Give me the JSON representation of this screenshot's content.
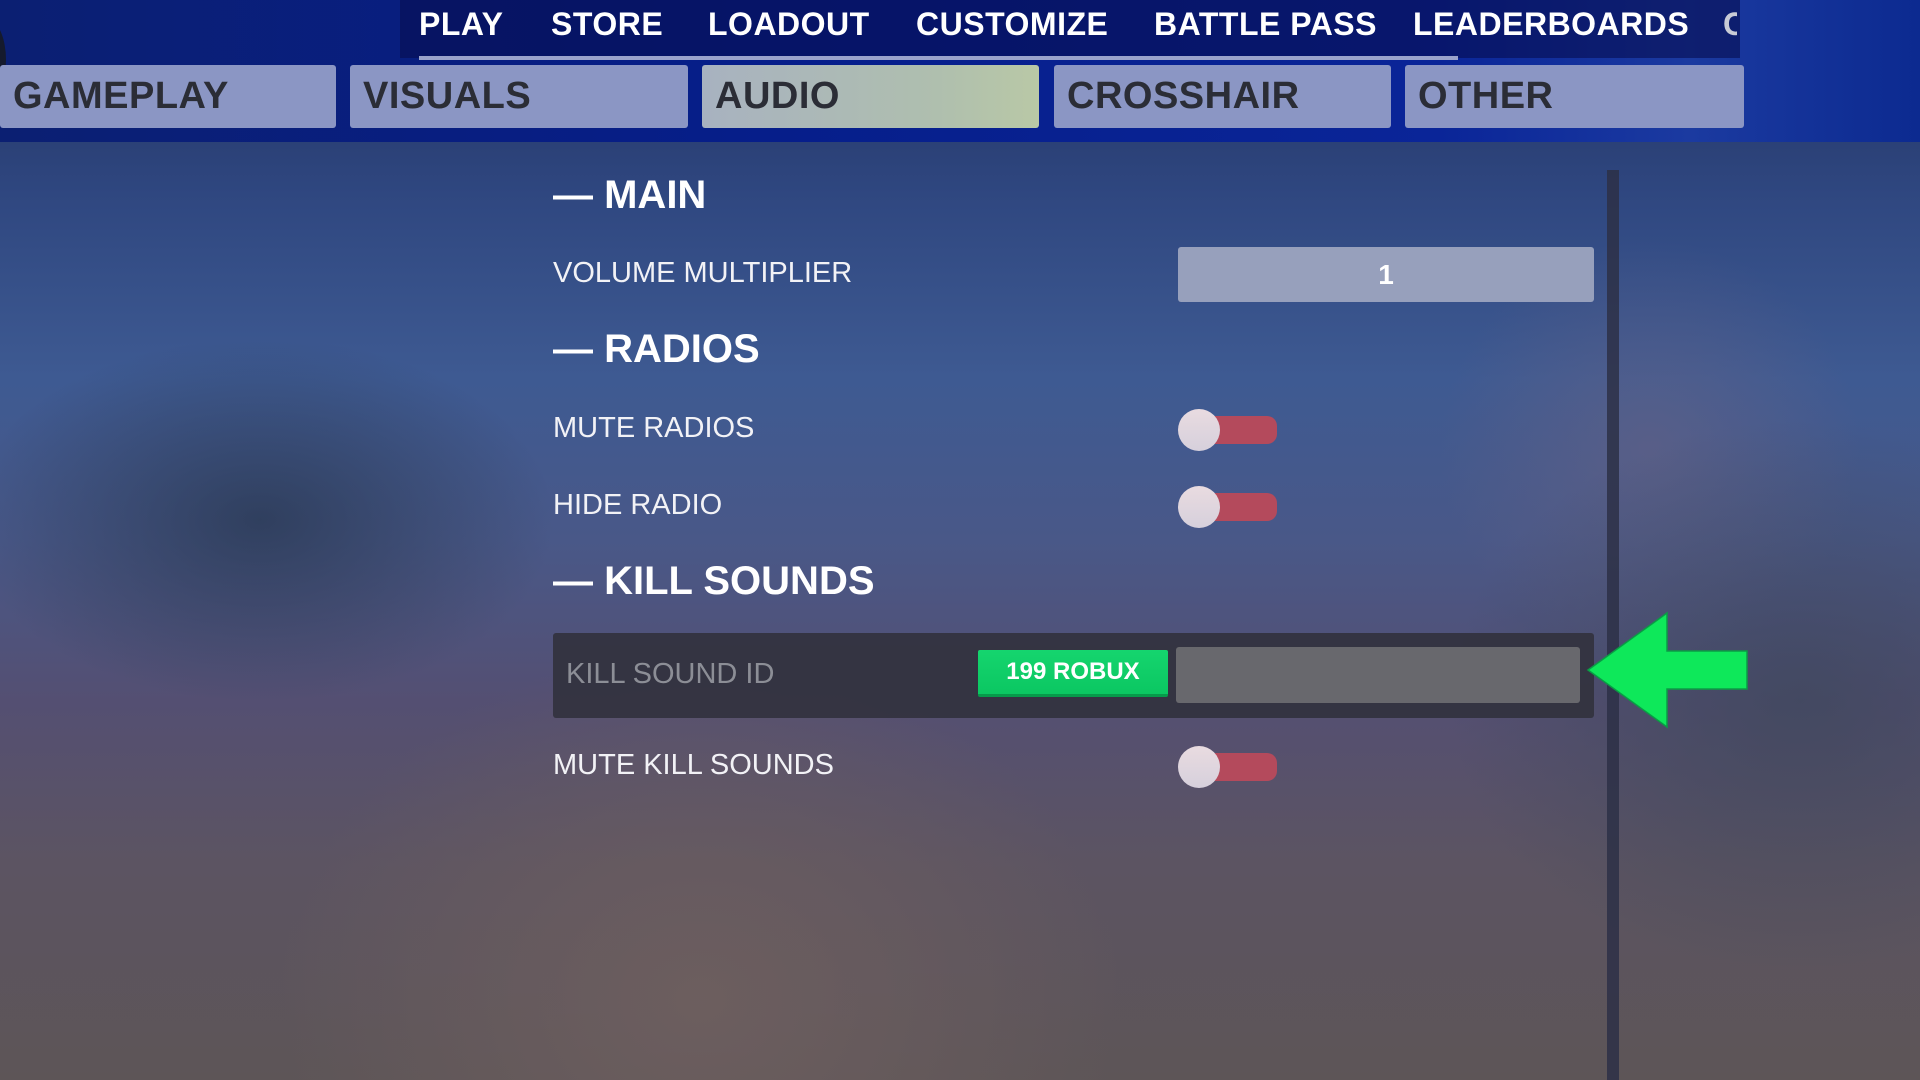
{
  "top_nav": {
    "items": [
      {
        "label": "PLAY"
      },
      {
        "label": "STORE"
      },
      {
        "label": "LOADOUT"
      },
      {
        "label": "CUSTOMIZE"
      },
      {
        "label": "BATTLE PASS"
      },
      {
        "label": "LEADERBOARDS"
      },
      {
        "label": "C"
      }
    ]
  },
  "settings_tabs": {
    "items": [
      {
        "label": "GAMEPLAY"
      },
      {
        "label": "VISUALS"
      },
      {
        "label": "AUDIO",
        "active": true
      },
      {
        "label": "CROSSHAIR"
      },
      {
        "label": "OTHER"
      }
    ]
  },
  "sections": {
    "main": {
      "title": "— MAIN",
      "volume_multiplier": {
        "label": "VOLUME MULTIPLIER",
        "value": "1"
      }
    },
    "radios": {
      "title": "— RADIOS",
      "mute_radios": {
        "label": "MUTE RADIOS",
        "enabled": false
      },
      "hide_radio": {
        "label": "HIDE RADIO",
        "enabled": false
      }
    },
    "kill_sounds": {
      "title": "— KILL SOUNDS",
      "kill_sound_id": {
        "label": "KILL SOUND ID",
        "purchase_label": "199 ROBUX",
        "value": "",
        "placeholder": ""
      },
      "mute_kill_sounds": {
        "label": "MUTE KILL SOUNDS",
        "enabled": false
      }
    }
  },
  "colors": {
    "toggle_off": "#b44a5c",
    "robux_button": "#12d068",
    "annotation_arrow": "#0ee85a",
    "active_tab": "#afbfae",
    "tab": "#8b96c4"
  },
  "annotation": {
    "icon": "arrow-left-icon"
  }
}
